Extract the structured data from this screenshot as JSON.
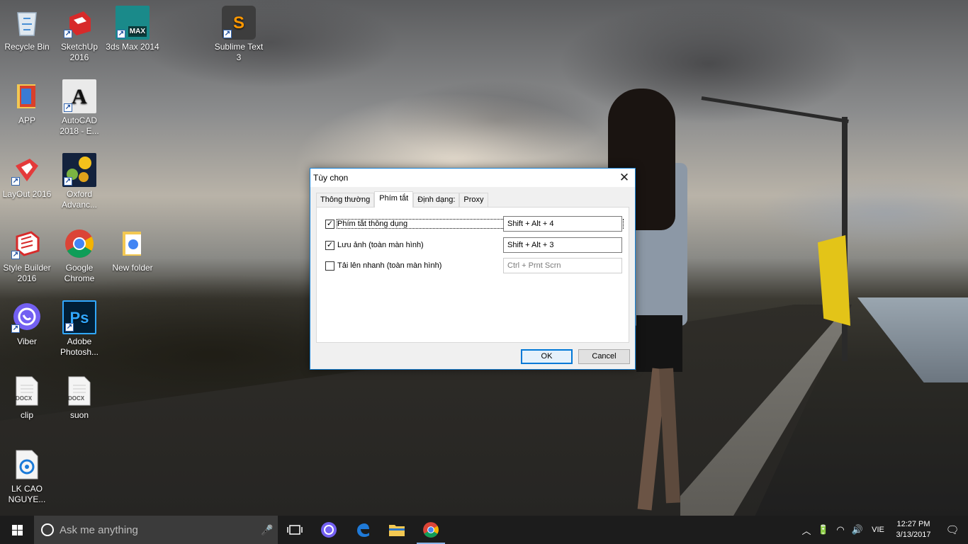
{
  "desktop": {
    "icons": [
      {
        "label": "Recycle Bin",
        "icon": "recycle-bin-icon"
      },
      {
        "label": "SketchUp 2016",
        "icon": "sketchup-icon"
      },
      {
        "label": "3ds Max 2014",
        "icon": "3ds-max-icon"
      },
      {
        "label": "Sublime Text 3",
        "icon": "sublime-text-icon"
      },
      {
        "label": "APP",
        "icon": "folder-icon"
      },
      {
        "label": "AutoCAD 2018 - E...",
        "icon": "autocad-icon"
      },
      {
        "label": "LayOut 2016",
        "icon": "layout-icon"
      },
      {
        "label": "Oxford Advanc...",
        "icon": "oxford-dictionary-icon"
      },
      {
        "label": "Style Builder 2016",
        "icon": "style-builder-icon"
      },
      {
        "label": "Google Chrome",
        "icon": "chrome-icon"
      },
      {
        "label": "New folder",
        "icon": "folder-icon"
      },
      {
        "label": "Viber",
        "icon": "viber-icon"
      },
      {
        "label": "Adobe Photosh...",
        "icon": "photoshop-icon"
      },
      {
        "label": "clip",
        "icon": "docx-file-icon",
        "badge": "DOCX"
      },
      {
        "label": "suon",
        "icon": "docx-file-icon",
        "badge": "DOCX"
      },
      {
        "label": "LK CAO NGUYE...",
        "icon": "media-file-icon"
      }
    ],
    "badges": {
      "max": "MAX",
      "ps": "Ps",
      "sublime": "S",
      "autocad": "A"
    }
  },
  "dialog": {
    "title": "Tùy chọn",
    "close": "✕",
    "tabs": [
      {
        "label": "Thông thường"
      },
      {
        "label": "Phím tắt"
      },
      {
        "label": "Định dạng:"
      },
      {
        "label": "Proxy"
      }
    ],
    "active_tab": "Phím tắt",
    "rows": [
      {
        "label": "Phím tắt thông dụng",
        "checked": true,
        "hotkey": "Shift + Alt + 4"
      },
      {
        "label": "Lưu ảnh (toàn màn hình)",
        "checked": true,
        "hotkey": "Shift + Alt + 3"
      },
      {
        "label": "Tải lên nhanh (toàn màn hình)",
        "checked": false,
        "hotkey": "Ctrl + Prnt Scrn"
      }
    ],
    "checkmark": "✓",
    "ok_label": "OK",
    "cancel_label": "Cancel"
  },
  "taskbar": {
    "search_placeholder": "Ask me anything",
    "mic": "🎤",
    "apps": [
      "task-view-icon",
      "viber-icon",
      "edge-icon",
      "file-explorer-icon",
      "chrome-icon"
    ],
    "running_app": "chrome-icon",
    "tray": {
      "chevron": "︿",
      "battery": "🔋",
      "wifi": "◠",
      "volume": "🔊",
      "language": "VIE",
      "time": "12:27 PM",
      "date": "3/13/2017",
      "notifications": "🗨"
    }
  },
  "colors": {
    "dialog_border": "#1883d7",
    "taskbar_bg": "#1c1c1c",
    "chrome_red": "#db4437",
    "chrome_green": "#0f9d58",
    "chrome_yellow": "#f4b400",
    "chrome_blue": "#4285f4",
    "viber_purple": "#7360f2",
    "photoshop_blue": "#001e36",
    "photoshop_accent": "#31a8ff",
    "sketchup_red": "#d72a2a",
    "folder_yellow": "#f3c852",
    "edge_blue": "#1f7ad8"
  }
}
